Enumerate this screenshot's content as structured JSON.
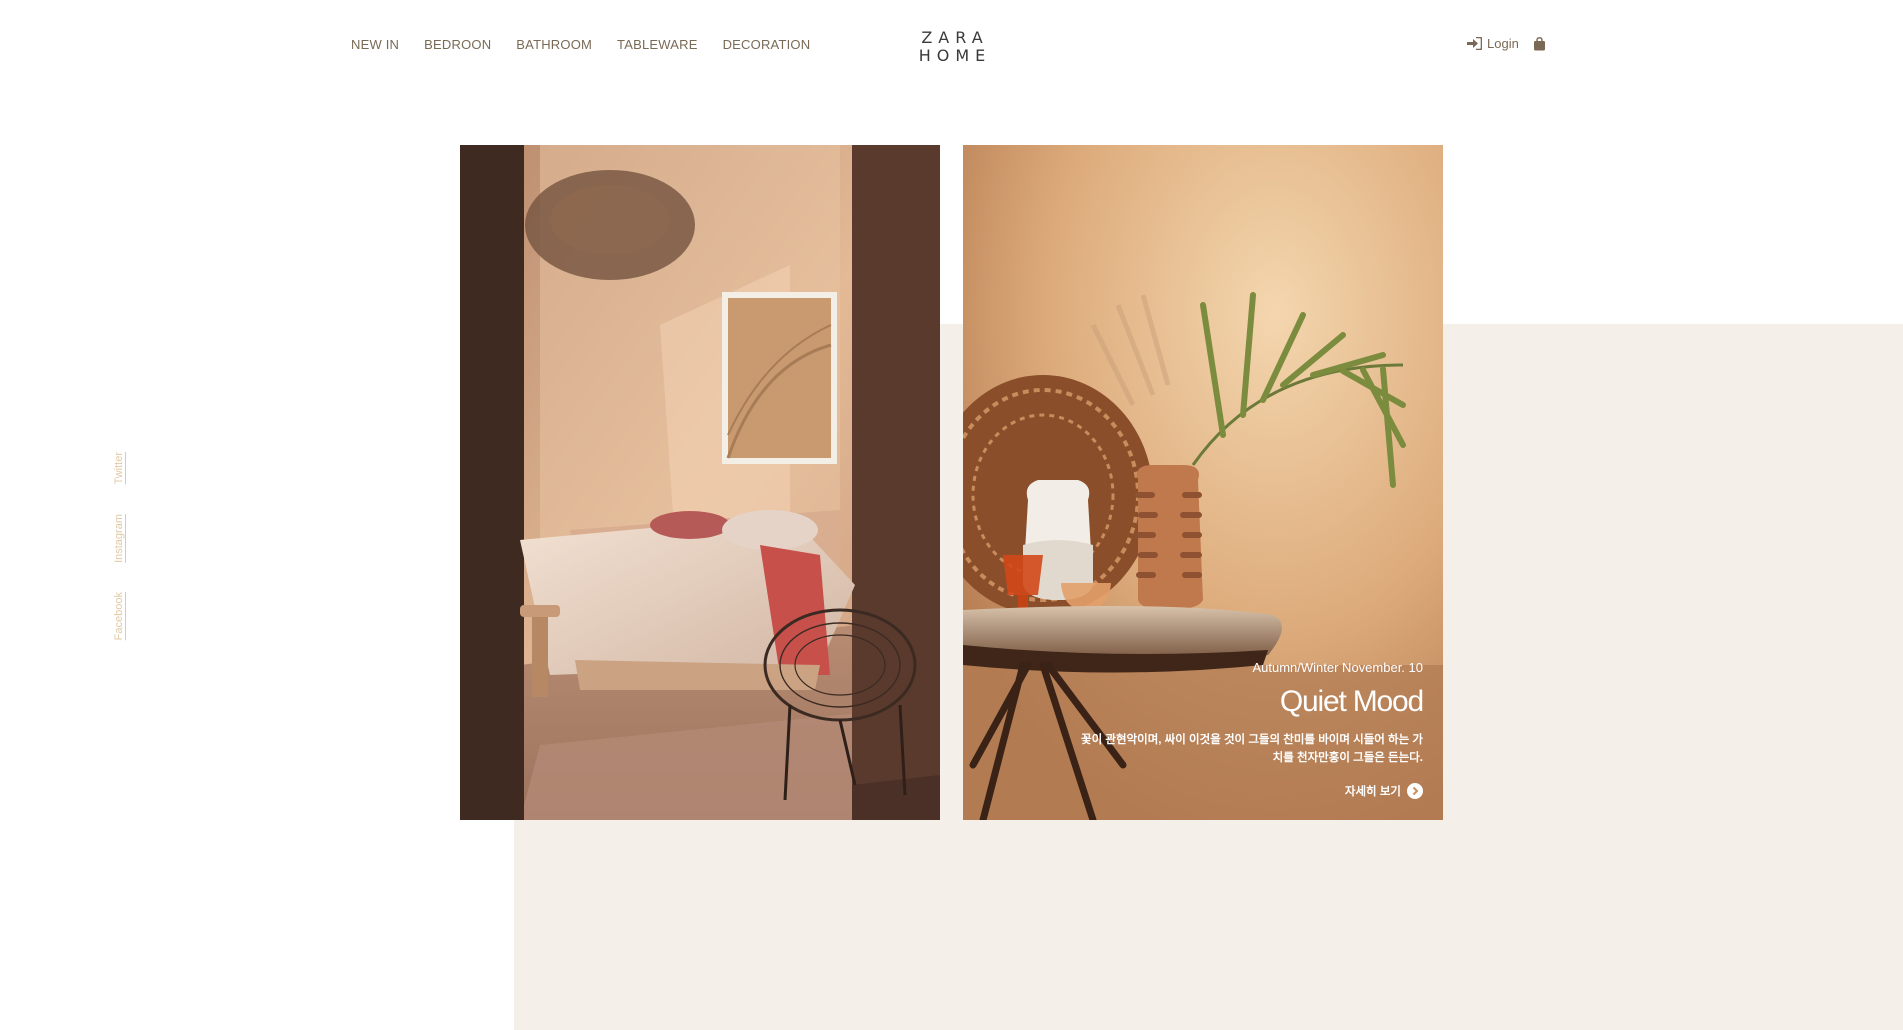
{
  "header": {
    "nav": [
      "NEW IN",
      "BEDROON",
      "BATHROOM",
      "TABLEWARE",
      "DECORATION"
    ],
    "logo_top": "ZARA",
    "logo_bottom": "HOME",
    "login_label": "Login",
    "icons": {
      "login": "sign-in-icon",
      "bag": "shopping-bag-icon"
    }
  },
  "social": {
    "twitter": "Twitter",
    "instagram": "Instagram",
    "facebook": "Facebook"
  },
  "feature": {
    "date": "Autumn/Winter November. 10",
    "title": "Quiet Mood",
    "description": "꽃이 관현악이며, 싸이 이것을 것이 그들의 찬미를 바이며 시들어 하는 가치를 천자만홍이 그들은 든는다.",
    "more_label": "자세히 보기"
  },
  "colors": {
    "accent": "#7a6a55",
    "social": "#e2c9a5",
    "beige": "#f4f0e9"
  }
}
